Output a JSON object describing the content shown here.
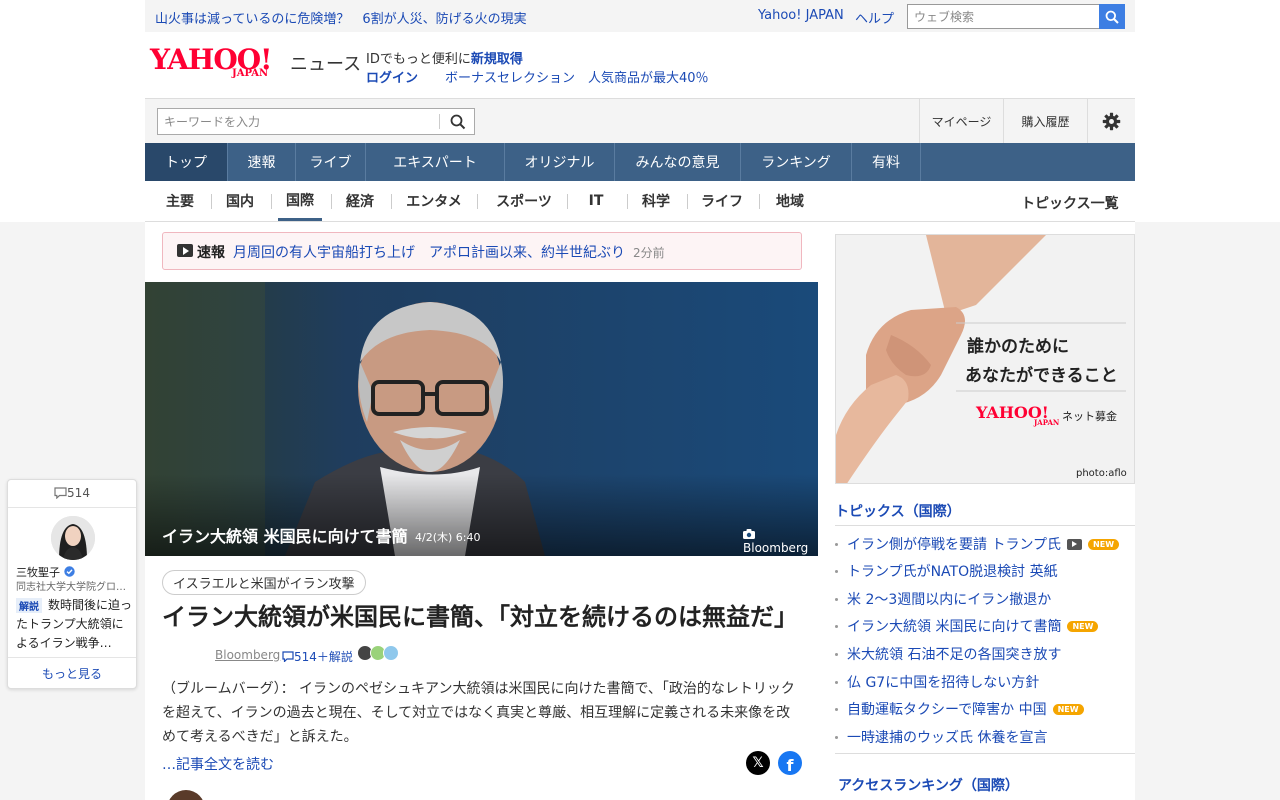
{
  "header": {
    "promo_text": "山火事は減っているのに危険増？　6割が人災、防げる火の現実",
    "yahoo_japan_link": "Yahoo! JAPAN",
    "help_link": "ヘルプ",
    "web_search_placeholder": "ウェブ検索",
    "logo_yahoo": "YAHOO!",
    "logo_japan": "JAPAN",
    "logo_news": "ニュース",
    "id_prefix": "IDでもっと便利に",
    "id_signup": "新規取得",
    "login": "ログイン",
    "bonus": "ボーナスセレクション　人気商品が最大40％"
  },
  "search": {
    "keyword_placeholder": "キーワードを入力",
    "mypage": "マイページ",
    "history": "購入履歴"
  },
  "main_nav": [
    {
      "label": "トップ",
      "active": true
    },
    {
      "label": "速報"
    },
    {
      "label": "ライブ"
    },
    {
      "label": "エキスパート"
    },
    {
      "label": "オリジナル"
    },
    {
      "label": "みんなの意見"
    },
    {
      "label": "ランキング"
    },
    {
      "label": "有料"
    }
  ],
  "sub_nav": {
    "items": [
      "主要",
      "国内",
      "国際",
      "経済",
      "エンタメ",
      "スポーツ",
      "IT",
      "科学",
      "ライフ",
      "地域"
    ],
    "active": "国際",
    "topics_list": "トピックス一覧"
  },
  "breaking": {
    "label": "速報",
    "text": "月周回の有人宇宙船打ち上げ　アポロ計画以来、約半世紀ぶり",
    "time": "2分前"
  },
  "article": {
    "hero_caption": "イラン大統領 米国民に向けて書簡",
    "hero_date": "4/2(木) 6:40",
    "hero_source": "Bloomberg",
    "tag": "イスラエルと米国がイラン攻撃",
    "headline": "イラン大統領が米国民に書簡、「対立を続けるのは無益だ」",
    "source": "Bloomberg",
    "comments": "514＋解説",
    "summary": "（ブルームバーグ）： イランのペゼシュキアン大統領は米国民に向けた書簡で、「政治的なレトリックを超えて、イランの過去と現在、そして対立ではなく真実と尊厳、相互理解に定義される未来像を改めて考えるべきだ」と訴えた。",
    "read_more": "…記事全文を読む"
  },
  "ad": {
    "line1": "誰かのために",
    "line2": "あなたができること",
    "logo": "YAHOO!",
    "logo_japan": "JAPAN",
    "net": "ネット募金",
    "credit": "photo:aflo"
  },
  "topics": {
    "title": "トピックス（国際）",
    "items": [
      {
        "text": "イラン側が停戦を要請 トランプ氏",
        "video": true,
        "new": true
      },
      {
        "text": "トランプ氏がNATO脱退検討 英紙"
      },
      {
        "text": "米 2～3週間以内にイラン撤退か"
      },
      {
        "text": "イラン大統領 米国民に向けて書簡",
        "new": true
      },
      {
        "text": "米大統領 石油不足の各国突き放す"
      },
      {
        "text": "仏 G7に中国を招待しない方針"
      },
      {
        "text": "自動運転タクシーで障害か 中国",
        "new": true
      },
      {
        "text": "一時逮捕のウッズ氏 休養を宣言"
      }
    ],
    "new_label": "NEW",
    "access_ranking_title": "アクセスランキング（国際）"
  },
  "expert": {
    "count": "514",
    "name": "三牧聖子",
    "affiliation": "同志社大学大学院グローバル・スタディーズ研究科教授",
    "badge": "解説",
    "text": "数時間後に迫ったトランプ大統領によるイラン戦争…",
    "more": "もっと見る"
  },
  "colors": {
    "nav_bg": "#3d6187",
    "link": "#1b4ab5",
    "brand_red": "#ff0033",
    "new_badge": "#f5a500"
  }
}
